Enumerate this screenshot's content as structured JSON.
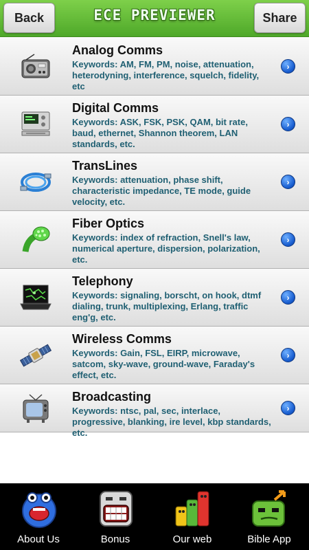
{
  "header": {
    "back_label": "Back",
    "title": "ECE PREVIEWER",
    "share_label": "Share"
  },
  "topics": [
    {
      "title": "Analog Comms",
      "desc": "Keywords: AM, FM, PM, noise, attenuation, heterodyning, interference, squelch, fidelity, etc",
      "icon": "radio-icon"
    },
    {
      "title": "Digital Comms",
      "desc": "Keywords: ASK, FSK, PSK, QAM, bit rate, baud, ethernet, Shannon theorem, LAN standards, etc.",
      "icon": "computer-terminal-icon"
    },
    {
      "title": "TransLines",
      "desc": "Keywords: attenuation, phase shift, characteristic impedance, TE mode, guide velocity, etc.",
      "icon": "cable-icon"
    },
    {
      "title": "Fiber Optics",
      "desc": "Keywords: index of refraction, Snell's law, numerical aperture, dispersion, polarization, etc.",
      "icon": "fiber-bundle-icon"
    },
    {
      "title": "Telephony",
      "desc": "Keywords: signaling, borscht, on hook, dtmf dialing, trunk, multiplexing, Erlang, traffic eng'g, etc.",
      "icon": "laptop-map-icon"
    },
    {
      "title": "Wireless Comms",
      "desc": "Keywords: Gain, FSL, EIRP, microwave, satcom, sky-wave, ground-wave, Faraday's effect, etc.",
      "icon": "satellite-icon"
    },
    {
      "title": "Broadcasting",
      "desc": "Keywords: ntsc, pal, sec, interlace, progressive, blanking, ire level, kbp standards, etc.",
      "icon": "tv-icon"
    }
  ],
  "tabs": [
    {
      "label": "About Us",
      "icon": "blue-monster-icon"
    },
    {
      "label": "Bonus",
      "icon": "grinning-face-icon"
    },
    {
      "label": "Our web",
      "icon": "colored-blocks-icon"
    },
    {
      "label": "Bible App",
      "icon": "green-monster-icon"
    }
  ],
  "colors": {
    "header_green": "#5cb835",
    "keyword_text": "#1f5f72",
    "chevron_blue": "#1a5fd1",
    "tabbar_bg": "#000000"
  }
}
